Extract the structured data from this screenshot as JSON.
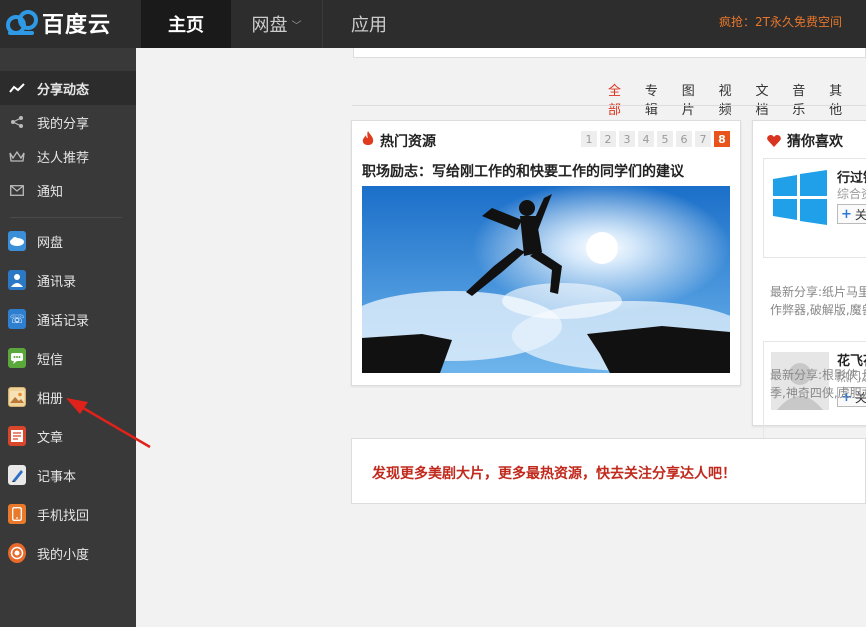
{
  "header": {
    "logo_text": "百度云",
    "nav": {
      "home": "主页",
      "pan": "网盘",
      "app": "应用"
    },
    "promo": "疯抢：2T永久免费空间"
  },
  "sidebar": {
    "social": [
      {
        "label": "分享动态",
        "icon": "activity-icon"
      },
      {
        "label": "我的分享",
        "icon": "share-icon"
      },
      {
        "label": "达人推荐",
        "icon": "crown-icon"
      },
      {
        "label": "通知",
        "icon": "mail-icon"
      }
    ],
    "apps": [
      {
        "label": "网盘",
        "icon": "cloud-icon",
        "color": "#3b8fd9"
      },
      {
        "label": "通讯录",
        "icon": "contacts-icon",
        "color": "#2b78c5"
      },
      {
        "label": "通话记录",
        "icon": "call-log-icon",
        "color": "#2f7fd1"
      },
      {
        "label": "短信",
        "icon": "sms-icon",
        "color": "#5aa83c"
      },
      {
        "label": "相册",
        "icon": "photo-album-icon",
        "color": "#f0d39a"
      },
      {
        "label": "文章",
        "icon": "article-icon",
        "color": "#d9462b"
      },
      {
        "label": "记事本",
        "icon": "notepad-icon",
        "color": "#e9e9e9"
      },
      {
        "label": "手机找回",
        "icon": "phone-find-icon",
        "color": "#e9792b"
      },
      {
        "label": "我的小度",
        "icon": "xiaodu-icon",
        "color": "#e9692b"
      }
    ]
  },
  "filters": [
    "全部",
    "专辑",
    "图片",
    "视频",
    "文档",
    "音乐",
    "其他"
  ],
  "hot": {
    "title": "热门资源",
    "pages": [
      "1",
      "2",
      "3",
      "4",
      "5",
      "6",
      "7",
      "8"
    ],
    "current_page": "8",
    "headline": "职场励志：写给刚工作的和快要工作的同学们的建议"
  },
  "guess": {
    "title": "猜你喜欢",
    "items": [
      {
        "name": "行过镜",
        "sub": "综合资",
        "follow": "关",
        "recent": [
          "最新分享:纸片马里",
          "作弊器,破解版,魔兽"
        ]
      },
      {
        "name": "花飞花",
        "sub": "热门之",
        "follow": "关",
        "recent": [
          "最新分享:根影侠,月",
          "季,神奇四侠,虎胆龙"
        ]
      }
    ]
  },
  "discover": "发现更多美剧大片，更多最热资源，快去关注分享达人吧！",
  "colors": {
    "accent": "#d9341f",
    "topbar": "#2d2d2d",
    "sidebar": "#393939",
    "promo": "#e8762b"
  }
}
